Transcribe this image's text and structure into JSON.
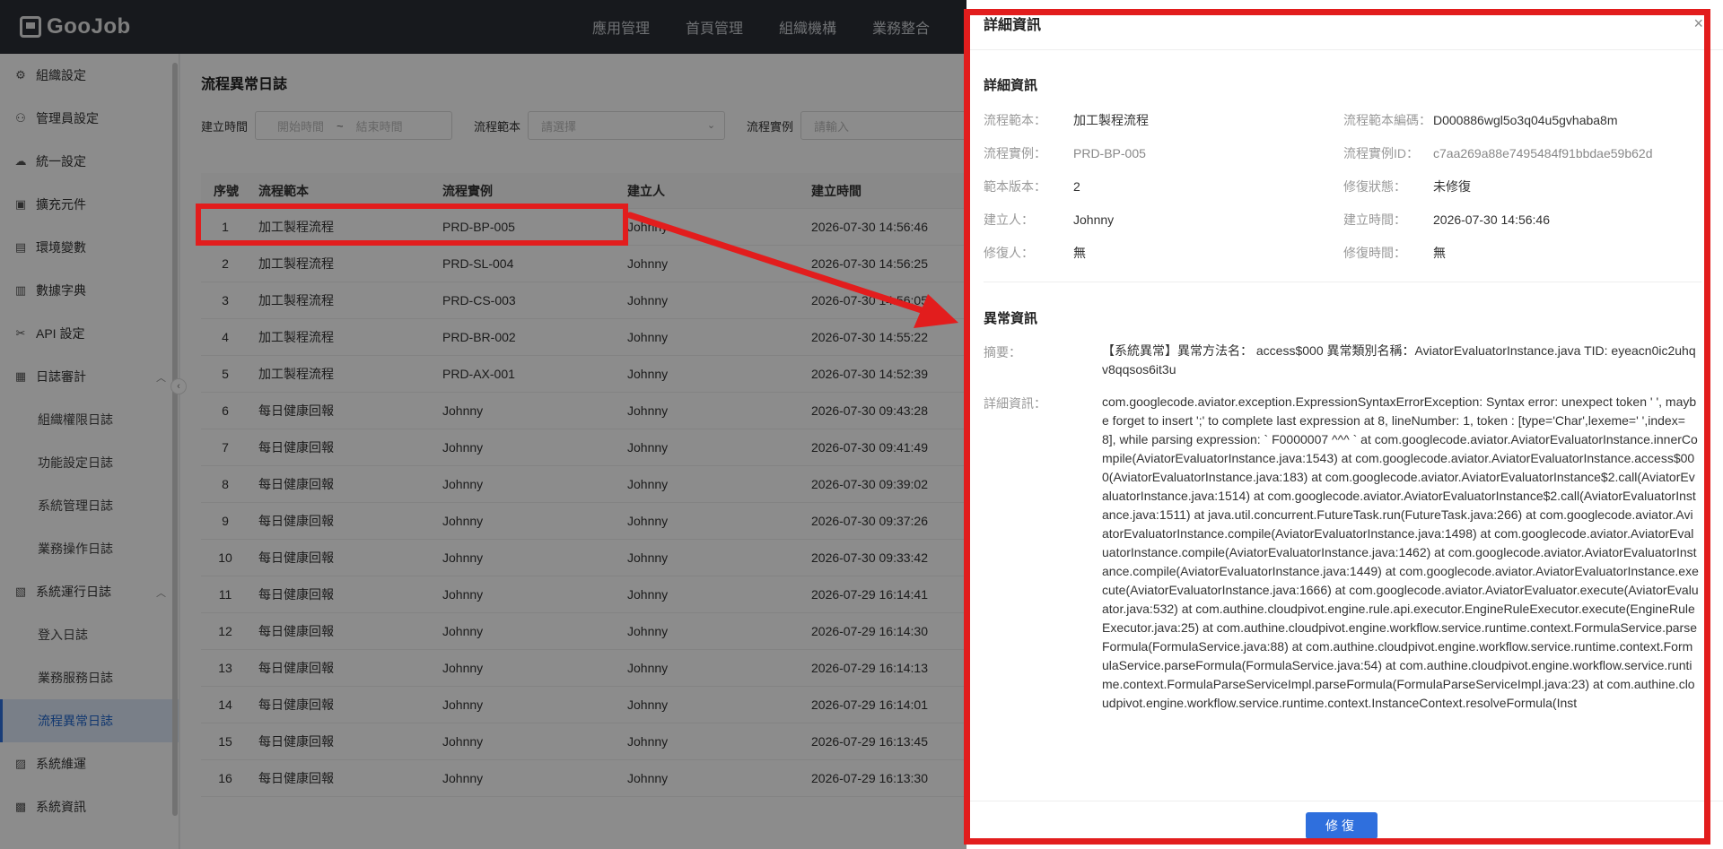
{
  "header": {
    "logo_text": "GooJob",
    "nav": [
      "應用管理",
      "首頁管理",
      "組織機構",
      "業務整合"
    ]
  },
  "sidebar": {
    "items": [
      {
        "label": "組織設定",
        "icon": "gear-icon",
        "glyph": "⚙"
      },
      {
        "label": "管理員設定",
        "icon": "user-icon",
        "glyph": "⚇"
      },
      {
        "label": "統一設定",
        "icon": "cloud-icon",
        "glyph": "☁"
      },
      {
        "label": "擴充元件",
        "icon": "box-icon",
        "glyph": "▣"
      },
      {
        "label": "環境變數",
        "icon": "grid-icon",
        "glyph": "▤"
      },
      {
        "label": "數據字典",
        "icon": "book-icon",
        "glyph": "▥"
      },
      {
        "label": "API 設定",
        "icon": "tools-icon",
        "glyph": "✂"
      },
      {
        "label": "日誌審計",
        "icon": "doc-icon",
        "glyph": "▦"
      }
    ],
    "audit_subitems": [
      "組織權限日誌",
      "功能設定日誌",
      "系統管理日誌",
      "業務操作日誌"
    ],
    "runlog": {
      "label": "系統運行日誌",
      "icon": "log-icon",
      "glyph": "▧"
    },
    "runlog_subitems": [
      "登入日誌",
      "業務服務日誌",
      "流程異常日誌"
    ],
    "bottom_items": [
      {
        "label": "系統維運",
        "icon": "wrench-icon",
        "glyph": "▨"
      },
      {
        "label": "系統資訊",
        "icon": "info-icon",
        "glyph": "▩"
      }
    ]
  },
  "main": {
    "title": "流程異常日誌",
    "filters": {
      "created_label": "建立時間",
      "start_placeholder": "開始時間",
      "range_sep": "~",
      "end_placeholder": "結束時間",
      "template_label": "流程範本",
      "template_placeholder": "請選擇",
      "instance_label": "流程實例",
      "instance_placeholder": "請輸入"
    },
    "columns": [
      "序號",
      "流程範本",
      "流程實例",
      "建立人",
      "建立時間"
    ],
    "rows": [
      [
        "1",
        "加工製程流程",
        "PRD-BP-005",
        "Johnny",
        "2026-07-30 14:56:46"
      ],
      [
        "2",
        "加工製程流程",
        "PRD-SL-004",
        "Johnny",
        "2026-07-30 14:56:25"
      ],
      [
        "3",
        "加工製程流程",
        "PRD-CS-003",
        "Johnny",
        "2026-07-30 14:56:05"
      ],
      [
        "4",
        "加工製程流程",
        "PRD-BR-002",
        "Johnny",
        "2026-07-30 14:55:22"
      ],
      [
        "5",
        "加工製程流程",
        "PRD-AX-001",
        "Johnny",
        "2026-07-30 14:52:39"
      ],
      [
        "6",
        "每日健康回報",
        "Johnny",
        "Johnny",
        "2026-07-30 09:43:28"
      ],
      [
        "7",
        "每日健康回報",
        "Johnny",
        "Johnny",
        "2026-07-30 09:41:49"
      ],
      [
        "8",
        "每日健康回報",
        "Johnny",
        "Johnny",
        "2026-07-30 09:39:02"
      ],
      [
        "9",
        "每日健康回報",
        "Johnny",
        "Johnny",
        "2026-07-30 09:37:26"
      ],
      [
        "10",
        "每日健康回報",
        "Johnny",
        "Johnny",
        "2026-07-30 09:33:42"
      ],
      [
        "11",
        "每日健康回報",
        "Johnny",
        "Johnny",
        "2026-07-29 16:14:41"
      ],
      [
        "12",
        "每日健康回報",
        "Johnny",
        "Johnny",
        "2026-07-29 16:14:30"
      ],
      [
        "13",
        "每日健康回報",
        "Johnny",
        "Johnny",
        "2026-07-29 16:14:13"
      ],
      [
        "14",
        "每日健康回報",
        "Johnny",
        "Johnny",
        "2026-07-29 16:14:01"
      ],
      [
        "15",
        "每日健康回報",
        "Johnny",
        "Johnny",
        "2026-07-29 16:13:45"
      ],
      [
        "16",
        "每日健康回報",
        "Johnny",
        "Johnny",
        "2026-07-29 16:13:30"
      ]
    ]
  },
  "modal": {
    "title": "詳細資訊",
    "close": "×",
    "section1": "詳細資訊",
    "fields_left": [
      {
        "k": "流程範本：",
        "v": "加工製程流程"
      },
      {
        "k": "流程實例：",
        "v": "PRD-BP-005"
      },
      {
        "k": "範本版本：",
        "v": "2"
      },
      {
        "k": "建立人：",
        "v": "Johnny"
      },
      {
        "k": "修復人：",
        "v": "無"
      }
    ],
    "fields_right": [
      {
        "k": "流程範本編碼：",
        "v": "D000886wgl5o3q04u5gvhaba8m"
      },
      {
        "k": "流程實例ID：",
        "v": "c7aa269a88e7495484f91bbdae59b62d"
      },
      {
        "k": "修復狀態：",
        "v": "未修復"
      },
      {
        "k": "建立時間：",
        "v": "2026-07-30 14:56:46"
      },
      {
        "k": "修復時間：",
        "v": "無"
      }
    ],
    "section2": "異常資訊",
    "summary_label": "摘要：",
    "summary": "【系統異常】異常方法名： access$000 異常類別名稱：AviatorEvaluatorInstance.java TID: eyeacn0ic2uhqv8qqsos6it3u",
    "detail_label": "詳細資訊：",
    "detail": "com.googlecode.aviator.exception.ExpressionSyntaxErrorException: Syntax error: unexpect token ' ', maybe forget to insert ';' to complete last expression at 8, lineNumber: 1, token : [type='Char',lexeme=' ',index=8], while parsing expression: ` F0000007 ^^^ ` at com.googlecode.aviator.AviatorEvaluatorInstance.innerCompile(AviatorEvaluatorInstance.java:1543) at com.googlecode.aviator.AviatorEvaluatorInstance.access$000(AviatorEvaluatorInstance.java:183) at com.googlecode.aviator.AviatorEvaluatorInstance$2.call(AviatorEvaluatorInstance.java:1514) at com.googlecode.aviator.AviatorEvaluatorInstance$2.call(AviatorEvaluatorInstance.java:1511) at java.util.concurrent.FutureTask.run(FutureTask.java:266) at com.googlecode.aviator.AviatorEvaluatorInstance.compile(AviatorEvaluatorInstance.java:1498) at com.googlecode.aviator.AviatorEvaluatorInstance.compile(AviatorEvaluatorInstance.java:1462) at com.googlecode.aviator.AviatorEvaluatorInstance.compile(AviatorEvaluatorInstance.java:1449) at com.googlecode.aviator.AviatorEvaluatorInstance.execute(AviatorEvaluatorInstance.java:1666) at com.googlecode.aviator.AviatorEvaluator.execute(AviatorEvaluator.java:532) at com.authine.cloudpivot.engine.rule.api.executor.EngineRuleExecutor.execute(EngineRuleExecutor.java:25) at com.authine.cloudpivot.engine.workflow.service.runtime.context.FormulaService.parseFormula(FormulaService.java:88) at com.authine.cloudpivot.engine.workflow.service.runtime.context.FormulaService.parseFormula(FormulaService.java:54) at com.authine.cloudpivot.engine.workflow.service.runtime.context.FormulaParseServiceImpl.parseFormula(FormulaParseServiceImpl.java:23) at com.authine.cloudpivot.engine.workflow.service.runtime.context.InstanceContext.resolveFormula(Inst",
    "repair_button": "修復"
  }
}
